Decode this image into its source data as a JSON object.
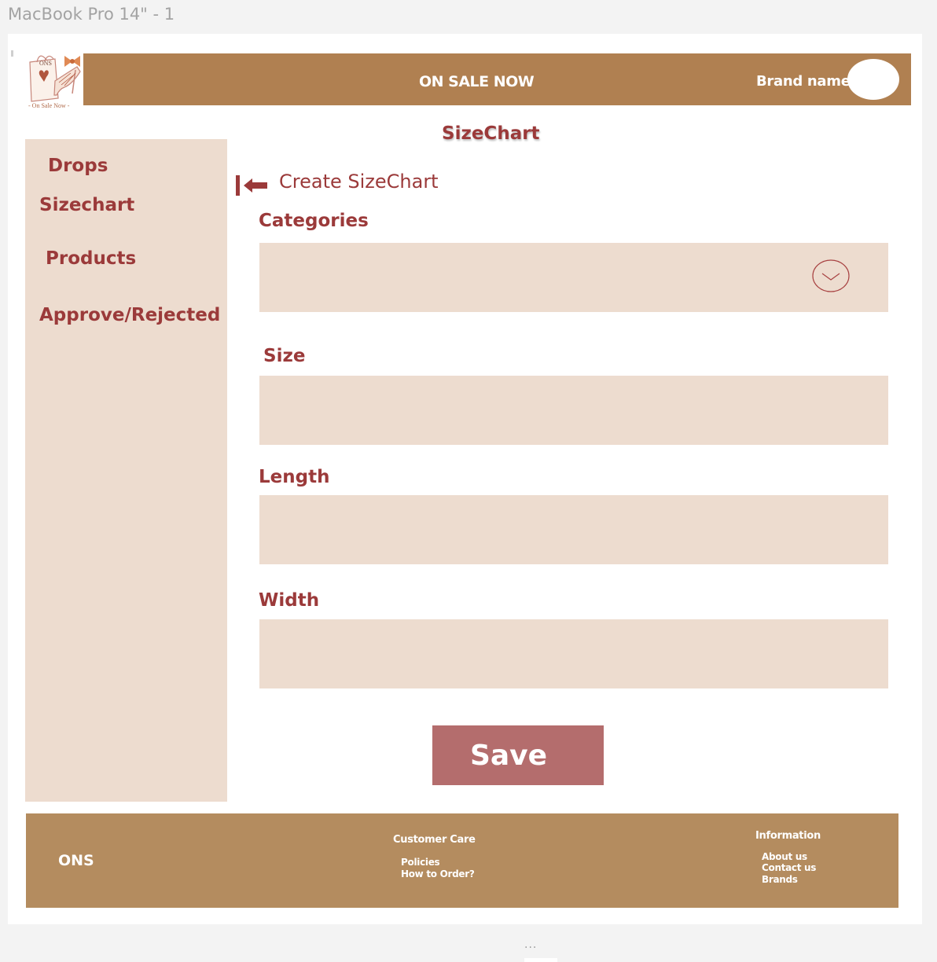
{
  "canvas": {
    "frame_title": "MacBook Pro 14\" - 1",
    "more_indicator": "..."
  },
  "header": {
    "title": "ON SALE NOW",
    "brand_name": "Brand name",
    "logo_text": "ONS",
    "logo_caption": "- On Sale Now -",
    "colors": {
      "bar": "#b08051",
      "text": "#ffffff"
    }
  },
  "sidebar": {
    "items": [
      {
        "label": "Drops"
      },
      {
        "label": "Sizechart"
      },
      {
        "label": "Products"
      },
      {
        "label": "Approve/Rejected"
      }
    ],
    "colors": {
      "background": "#eddccf",
      "text": "#9b3a3a"
    }
  },
  "main": {
    "page_title": "SizeChart",
    "back_icon": "arrow-left-to-bar-icon",
    "section_title": "Create SizeChart",
    "fields": {
      "categories": {
        "label": "Categories",
        "value": "",
        "icon": "chevron-down-icon"
      },
      "size": {
        "label": "Size",
        "value": ""
      },
      "length": {
        "label": "Length",
        "value": ""
      },
      "width": {
        "label": "Width",
        "value": ""
      }
    },
    "save_label": "Save",
    "colors": {
      "field": "#eddccf",
      "label": "#9b3a3a",
      "save": "#b46d6d"
    }
  },
  "footer": {
    "brand": "ONS",
    "customer_care": {
      "heading": "Customer Care",
      "links": [
        "Policies",
        "How to Order?"
      ]
    },
    "information": {
      "heading": "Information",
      "links": [
        "About us",
        "Contact us",
        "Brands"
      ]
    },
    "colors": {
      "background": "#b48c5f",
      "text": "#ffffff"
    }
  }
}
